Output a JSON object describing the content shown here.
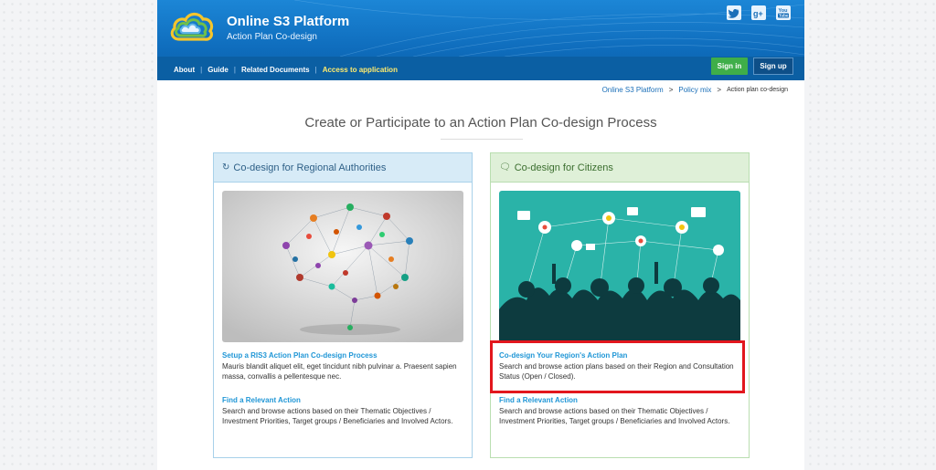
{
  "header": {
    "title": "Online S3 Platform",
    "subtitle": "Action Plan Co-design",
    "social": [
      "twitter-icon",
      "google-plus-icon",
      "youtube-icon"
    ]
  },
  "nav": {
    "about": "About",
    "guide": "Guide",
    "related": "Related Documents",
    "access": "Access to application",
    "signin": "Sign in",
    "signup": "Sign up"
  },
  "breadcrumb": {
    "home": "Online S3 Platform",
    "sep": ">",
    "policy": "Policy mix",
    "current": "Action plan co-design"
  },
  "main": {
    "heading": "Create or Participate to an Action Plan Co-design Process"
  },
  "cards": {
    "regional": {
      "title": "Co-design for Regional Authorities",
      "item1_title": "Setup a RIS3 Action Plan Co-design Process",
      "item1_desc": "Mauris blandit aliquet elit, eget tincidunt nibh pulvinar a. Praesent sapien massa, convallis a pellentesque nec.",
      "item2_title": "Find a Relevant Action",
      "item2_desc": "Search and browse actions based on their Thematic Objectives / Investment Priorities, Target groups / Beneficiaries and Involved Actors."
    },
    "citizens": {
      "title": "Co-design for Citizens",
      "item1_title": "Co-design Your Region's Action Plan",
      "item1_desc": "Search and browse action plans based on their Region and Consultation Status (Open / Closed).",
      "item2_title": "Find a Relevant Action",
      "item2_desc": "Search and browse actions based on their Thematic Objectives / Investment Priorities, Target groups / Beneficiaries and Involved Actors."
    }
  },
  "colors": {
    "header_blue": "#0f6dbd",
    "accent_yellow": "#ffeb6e",
    "signin_green": "#3fae49",
    "link_blue": "#1f96d6",
    "highlight_red": "#e2171d"
  }
}
